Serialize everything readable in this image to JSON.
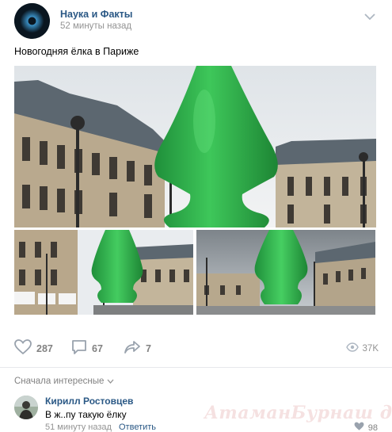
{
  "post": {
    "group_name": "Наука и Факты",
    "time": "52 минуты назад",
    "text": "Новогодняя ёлка в Париже",
    "icons": {
      "menu": "chevron-down-icon",
      "like": "heart-icon",
      "comment": "comment-bubble-icon",
      "share": "share-arrow-icon",
      "views": "eye-icon"
    }
  },
  "actions": {
    "likes": "287",
    "comments": "67",
    "shares": "7",
    "views": "37K"
  },
  "comments_section": {
    "sort_label": "Сначала интересные",
    "comment": {
      "author": "Кирилл Ростовцев",
      "text": "В ж..пу такую ёлку",
      "time": "51 минуту назад",
      "reply_label": "Ответить",
      "likes": "98"
    }
  },
  "watermark": "АтаманБурнаш для ЯП",
  "colors": {
    "link": "#2a5885",
    "muted": "#828282",
    "tree_green": "#2fae4a"
  }
}
